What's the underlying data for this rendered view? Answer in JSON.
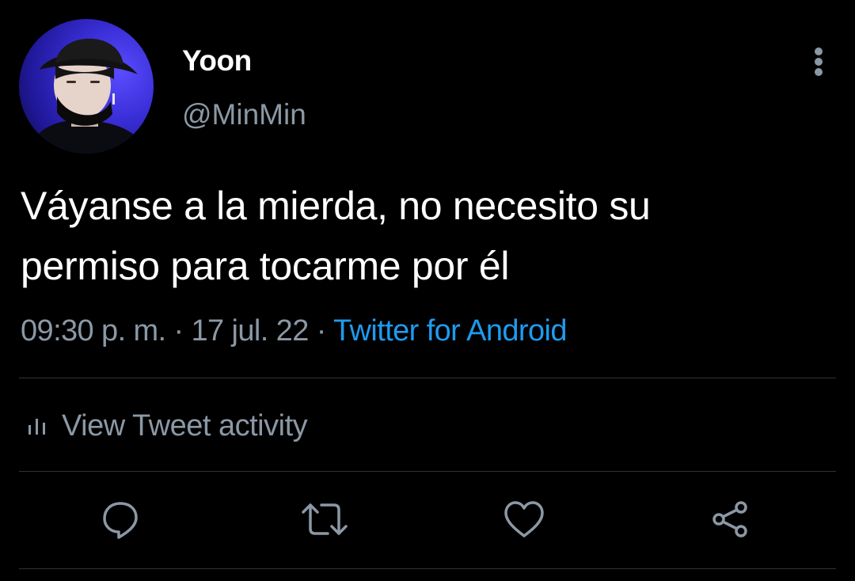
{
  "tweet": {
    "display_name": "Yoon",
    "handle": "@MinMin",
    "text_line_1": "Váyanse a la mierda, no necesito su",
    "text_line_2": "permiso para tocarme por él",
    "time": "09:30 p. m.",
    "separator": " · ",
    "date": "17 jul. 22",
    "source": "Twitter for Android",
    "activity_label": "View Tweet activity"
  },
  "icons": {
    "more": "more-vertical-icon",
    "activity": "bar-chart-icon",
    "reply": "reply-icon",
    "retweet": "retweet-icon",
    "like": "heart-icon",
    "share": "share-icon"
  },
  "colors": {
    "background": "#000000",
    "text": "#ffffff",
    "secondary": "#8b98a5",
    "link": "#1d9bf0",
    "divider": "#2f3336",
    "avatar_accent": "#3a2fd8"
  }
}
